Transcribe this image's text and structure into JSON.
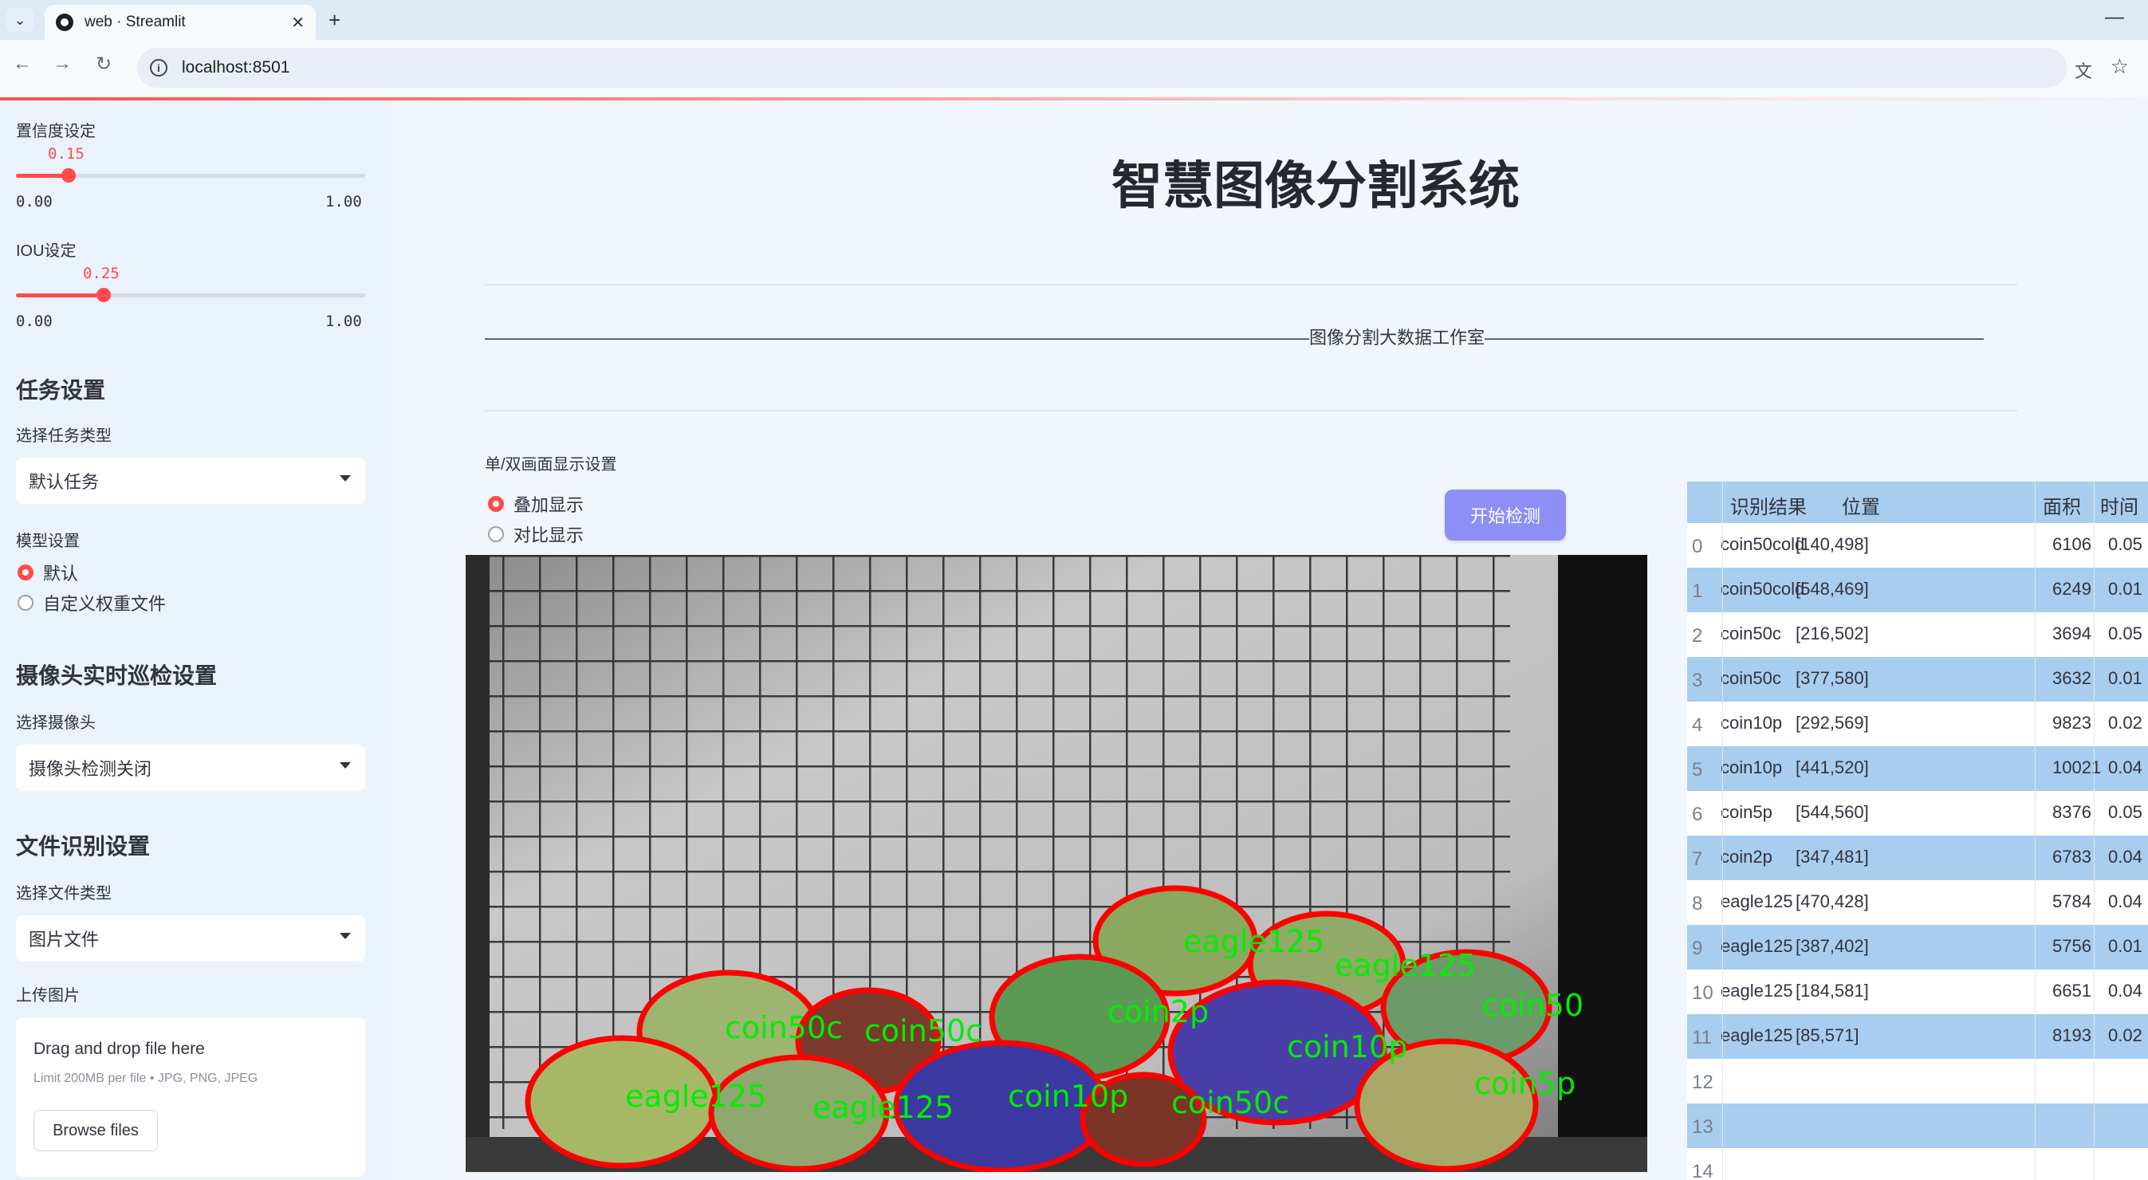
{
  "browser": {
    "tab_title": "web · Streamlit",
    "url": "localhost:8501"
  },
  "sidebar": {
    "confidence": {
      "label": "置信度设定",
      "value": "0.15",
      "value_num": 0.15,
      "min": "0.00",
      "max": "1.00"
    },
    "iou": {
      "label": "IOU设定",
      "value": "0.25",
      "value_num": 0.25,
      "min": "0.00",
      "max": "1.00"
    },
    "task_heading": "任务设置",
    "task_type_label": "选择任务类型",
    "task_type_value": "默认任务",
    "model_label": "模型设置",
    "model_options": [
      "默认",
      "自定义权重文件"
    ],
    "model_selected": 0,
    "camera_heading": "摄像头实时巡检设置",
    "camera_label": "选择摄像头",
    "camera_value": "摄像头检测关闭",
    "file_heading": "文件识别设置",
    "file_type_label": "选择文件类型",
    "file_type_value": "图片文件",
    "upload_label": "上传图片",
    "upload_title": "Drag and drop file here",
    "upload_sub": "Limit 200MB per file • JPG, PNG, JPEG",
    "browse_label": "Browse files"
  },
  "main": {
    "title": "智慧图像分割系统",
    "divider_text": "图像分割大数据工作室",
    "display_label": "单/双画面显示设置",
    "display_options": [
      "叠加显示",
      "对比显示"
    ],
    "display_selected": 0,
    "detect_button": "开始检测"
  },
  "detections": [
    {
      "label": "eagle125"
    },
    {
      "label": "eagle125"
    },
    {
      "label": "coin50"
    },
    {
      "label": "coin2p"
    },
    {
      "label": "coin10p"
    },
    {
      "label": "coin5p"
    },
    {
      "label": "coin50c"
    },
    {
      "label": "coin50c"
    },
    {
      "label": "eagle125"
    },
    {
      "label": "eagle125"
    },
    {
      "label": "coin10p"
    },
    {
      "label": "coin50c"
    }
  ],
  "table": {
    "headers": [
      "识别结果",
      "位置",
      "面积",
      "时间"
    ],
    "rows": [
      {
        "idx": "0",
        "result": "coin50cold",
        "pos": "[140,498]",
        "area": "6106",
        "time": "0.05"
      },
      {
        "idx": "1",
        "result": "coin50cold",
        "pos": "[548,469]",
        "area": "6249",
        "time": "0.01"
      },
      {
        "idx": "2",
        "result": "coin50c",
        "pos": "[216,502]",
        "area": "3694",
        "time": "0.05"
      },
      {
        "idx": "3",
        "result": "coin50c",
        "pos": "[377,580]",
        "area": "3632",
        "time": "0.01"
      },
      {
        "idx": "4",
        "result": "coin10p",
        "pos": "[292,569]",
        "area": "9823",
        "time": "0.02"
      },
      {
        "idx": "5",
        "result": "coin10p",
        "pos": "[441,520]",
        "area": "10021",
        "time": "0.04"
      },
      {
        "idx": "6",
        "result": "coin5p",
        "pos": "[544,560]",
        "area": "8376",
        "time": "0.05"
      },
      {
        "idx": "7",
        "result": "coin2p",
        "pos": "[347,481]",
        "area": "6783",
        "time": "0.04"
      },
      {
        "idx": "8",
        "result": "eagle125",
        "pos": "[470,428]",
        "area": "5784",
        "time": "0.04"
      },
      {
        "idx": "9",
        "result": "eagle125",
        "pos": "[387,402]",
        "area": "5756",
        "time": "0.01"
      },
      {
        "idx": "10",
        "result": "eagle125",
        "pos": "[184,581]",
        "area": "6651",
        "time": "0.04"
      },
      {
        "idx": "11",
        "result": "eagle125",
        "pos": "[85,571]",
        "area": "8193",
        "time": "0.02"
      },
      {
        "idx": "12",
        "result": "",
        "pos": "",
        "area": "",
        "time": ""
      },
      {
        "idx": "13",
        "result": "",
        "pos": "",
        "area": "",
        "time": ""
      },
      {
        "idx": "14",
        "result": "",
        "pos": "",
        "area": "",
        "time": ""
      }
    ]
  },
  "colors": {
    "accent": "#ff4b4b",
    "button": "#8d8ff6",
    "table_alt": "#a8cdee",
    "detection_box": "#ff0000",
    "detection_label": "#00ff00"
  }
}
